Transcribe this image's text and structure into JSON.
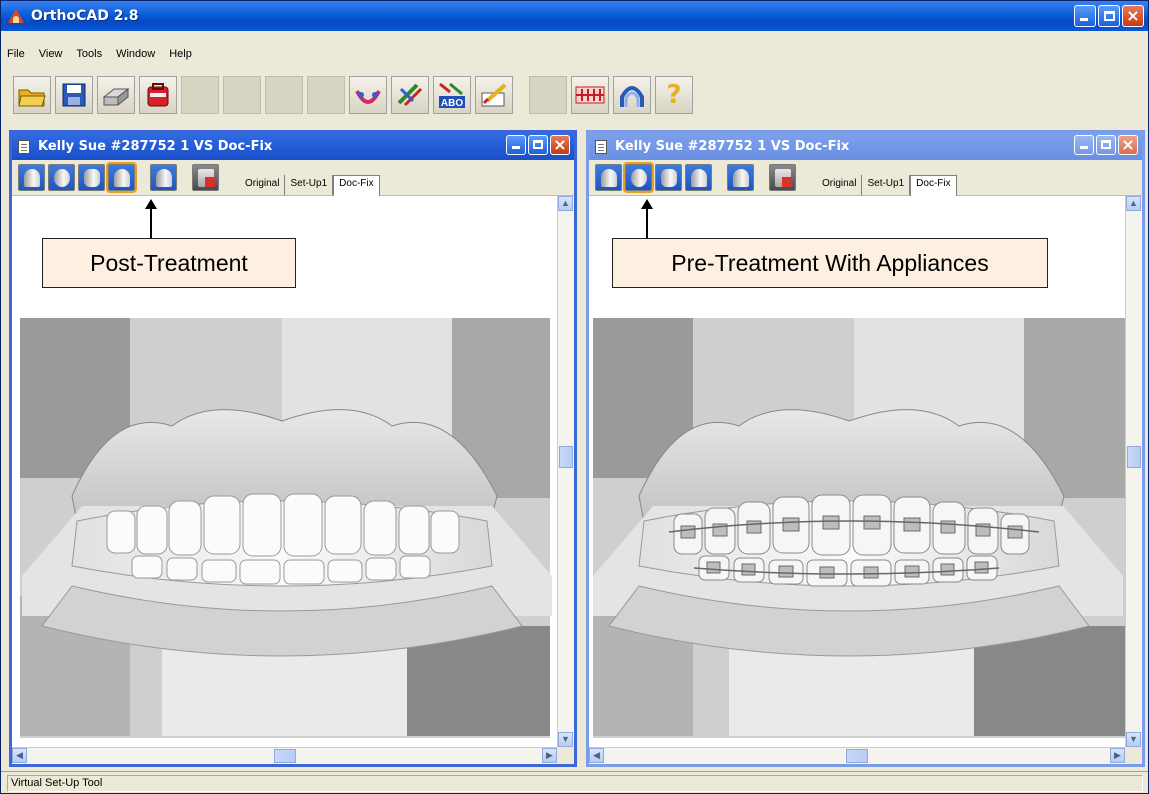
{
  "app": {
    "title": "OrthoCAD 2.8"
  },
  "menu": [
    "File",
    "View",
    "Tools",
    "Window",
    "Help"
  ],
  "toolbar": {
    "buttons": [
      {
        "icon": "open-folder-icon",
        "enabled": true
      },
      {
        "icon": "save-icon",
        "enabled": true
      },
      {
        "icon": "scanner-icon",
        "enabled": true
      },
      {
        "icon": "case-icon",
        "enabled": true
      },
      {
        "icon": "grayed-icon-1",
        "enabled": false
      },
      {
        "icon": "grayed-icon-2",
        "enabled": false
      },
      {
        "icon": "grayed-icon-3",
        "enabled": false
      },
      {
        "icon": "grayed-icon-4",
        "enabled": false
      },
      {
        "icon": "arch-wire-icon",
        "enabled": true
      },
      {
        "icon": "measure-icon",
        "enabled": true
      },
      {
        "icon": "abo-icon",
        "enabled": true,
        "label": "ABO"
      },
      {
        "icon": "annotate-icon",
        "enabled": true
      },
      {
        "icon": "grayed-icon-5",
        "enabled": false
      },
      {
        "icon": "brackets-icon",
        "enabled": true
      },
      {
        "icon": "arch-icon",
        "enabled": true
      },
      {
        "icon": "help-icon",
        "enabled": true,
        "label": "?"
      }
    ]
  },
  "windows": [
    {
      "title": "Kelly Sue #287752 1 VS Doc-Fix",
      "tabs": [
        "Original",
        "Set-Up1",
        "Doc-Fix"
      ],
      "selected_tab": "Doc-Fix",
      "view_buttons": [
        "front-view-icon",
        "occlusal-view-icon",
        "split-view-icon",
        "post-treatment-view-icon",
        "tooth-view-icon",
        "document-icon"
      ],
      "active_view": 3,
      "callout": "Post-Treatment"
    },
    {
      "title": "Kelly Sue #287752 1 VS Doc-Fix",
      "tabs": [
        "Original",
        "Set-Up1",
        "Doc-Fix"
      ],
      "selected_tab": "Doc-Fix",
      "view_buttons": [
        "front-view-icon",
        "appliance-view-icon",
        "split-view-icon",
        "post-treatment-view-icon",
        "tooth-view-icon",
        "document-icon"
      ],
      "active_view": 1,
      "callout": "Pre-Treatment With Appliances"
    }
  ],
  "status": {
    "text": "Virtual Set-Up Tool"
  },
  "colors": {
    "title_active": "#1b4fc8",
    "title_inactive": "#7ea1ec",
    "callout_fill": "#fdf0e0"
  }
}
